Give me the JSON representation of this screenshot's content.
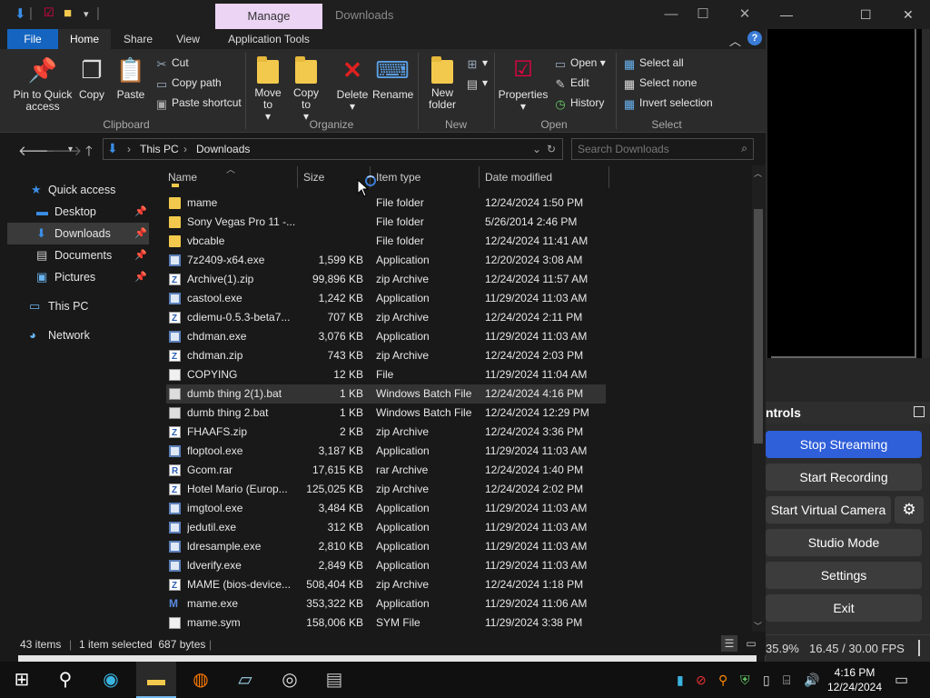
{
  "explorer": {
    "title": "Downloads",
    "manage_tab": "Manage",
    "window_controls": {
      "minimize": "—",
      "maximize": "☐",
      "close": "✕"
    },
    "ribbon_tabs": [
      "File",
      "Home",
      "Share",
      "View",
      "Application Tools"
    ],
    "help": "?",
    "ribbon": {
      "clipboard": {
        "label": "Clipboard",
        "pin": "Pin to Quick access",
        "copy": "Copy",
        "paste": "Paste",
        "cut": "Cut",
        "copy_path": "Copy path",
        "paste_shortcut": "Paste shortcut"
      },
      "organize": {
        "label": "Organize",
        "move_to": "Move to",
        "copy_to": "Copy to",
        "delete": "Delete",
        "rename": "Rename"
      },
      "new": {
        "label": "New",
        "new_folder": "New folder"
      },
      "open": {
        "label": "Open",
        "properties": "Properties",
        "open": "Open",
        "edit": "Edit",
        "history": "History"
      },
      "select": {
        "label": "Select",
        "select_all": "Select all",
        "select_none": "Select none",
        "invert": "Invert selection"
      }
    },
    "address": {
      "crumbs": [
        "This PC",
        "Downloads"
      ],
      "search_placeholder": "Search Downloads"
    },
    "nav": {
      "quick_access": "Quick access",
      "desktop": "Desktop",
      "downloads": "Downloads",
      "documents": "Documents",
      "pictures": "Pictures",
      "this_pc": "This PC",
      "network": "Network"
    },
    "columns": {
      "name": "Name",
      "size": "Size",
      "type": "Item type",
      "date": "Date modified"
    },
    "files": [
      {
        "name": "mame",
        "size": "",
        "type": "File folder",
        "date": "12/24/2024 1:50 PM",
        "icon": "folder"
      },
      {
        "name": "Sony Vegas Pro 11 -...",
        "size": "",
        "type": "File folder",
        "date": "5/26/2014 2:46 PM",
        "icon": "folder"
      },
      {
        "name": "vbcable",
        "size": "",
        "type": "File folder",
        "date": "12/24/2024 11:41 AM",
        "icon": "folder"
      },
      {
        "name": "7z2409-x64.exe",
        "size": "1,599 KB",
        "type": "Application",
        "date": "12/20/2024 3:08 AM",
        "icon": "app"
      },
      {
        "name": "Archive(1).zip",
        "size": "99,896 KB",
        "type": "zip Archive",
        "date": "12/24/2024 11:57 AM",
        "icon": "zip"
      },
      {
        "name": "castool.exe",
        "size": "1,242 KB",
        "type": "Application",
        "date": "11/29/2024 11:03 AM",
        "icon": "app"
      },
      {
        "name": "cdiemu-0.5.3-beta7...",
        "size": "707 KB",
        "type": "zip Archive",
        "date": "12/24/2024 2:11 PM",
        "icon": "zip"
      },
      {
        "name": "chdman.exe",
        "size": "3,076 KB",
        "type": "Application",
        "date": "11/29/2024 11:03 AM",
        "icon": "app"
      },
      {
        "name": "chdman.zip",
        "size": "743 KB",
        "type": "zip Archive",
        "date": "12/24/2024 2:03 PM",
        "icon": "zip"
      },
      {
        "name": "COPYING",
        "size": "12 KB",
        "type": "File",
        "date": "11/29/2024 11:04 AM",
        "icon": "file"
      },
      {
        "name": "dumb thing 2(1).bat",
        "size": "1 KB",
        "type": "Windows Batch File",
        "date": "12/24/2024 4:16 PM",
        "icon": "bat"
      },
      {
        "name": "dumb thing 2.bat",
        "size": "1 KB",
        "type": "Windows Batch File",
        "date": "12/24/2024 12:29 PM",
        "icon": "bat"
      },
      {
        "name": "FHAAFS.zip",
        "size": "2 KB",
        "type": "zip Archive",
        "date": "12/24/2024 3:36 PM",
        "icon": "zip"
      },
      {
        "name": "floptool.exe",
        "size": "3,187 KB",
        "type": "Application",
        "date": "11/29/2024 11:03 AM",
        "icon": "app"
      },
      {
        "name": "Gcom.rar",
        "size": "17,615 KB",
        "type": "rar Archive",
        "date": "12/24/2024 1:40 PM",
        "icon": "rar"
      },
      {
        "name": "Hotel Mario (Europ...",
        "size": "125,025 KB",
        "type": "zip Archive",
        "date": "12/24/2024 2:02 PM",
        "icon": "zip"
      },
      {
        "name": "imgtool.exe",
        "size": "3,484 KB",
        "type": "Application",
        "date": "11/29/2024 11:03 AM",
        "icon": "app"
      },
      {
        "name": "jedutil.exe",
        "size": "312 KB",
        "type": "Application",
        "date": "11/29/2024 11:03 AM",
        "icon": "app"
      },
      {
        "name": "ldresample.exe",
        "size": "2,810 KB",
        "type": "Application",
        "date": "11/29/2024 11:03 AM",
        "icon": "app"
      },
      {
        "name": "ldverify.exe",
        "size": "2,849 KB",
        "type": "Application",
        "date": "11/29/2024 11:03 AM",
        "icon": "app"
      },
      {
        "name": "MAME (bios-device...",
        "size": "508,404 KB",
        "type": "zip Archive",
        "date": "12/24/2024 1:18 PM",
        "icon": "zip"
      },
      {
        "name": "mame.exe",
        "size": "353,322 KB",
        "type": "Application",
        "date": "11/29/2024 11:06 AM",
        "icon": "mame"
      },
      {
        "name": "mame.sym",
        "size": "158,006 KB",
        "type": "SYM File",
        "date": "11/29/2024 3:38 PM",
        "icon": "file"
      }
    ],
    "status": {
      "items": "43 items",
      "selected": "1 item selected  687 bytes"
    }
  },
  "obs": {
    "controls_title": "ntrols",
    "buttons": {
      "stop_streaming": "Stop Streaming",
      "start_recording": "Start Recording",
      "start_virtual_camera": "Start Virtual Camera",
      "studio_mode": "Studio Mode",
      "settings": "Settings",
      "exit": "Exit"
    },
    "status_percent": "35.9%",
    "status_fps": "16.45 / 30.00 FPS",
    "accent": "#2f5fd9"
  },
  "taskbar": {
    "time": "4:16 PM",
    "date": "12/24/2024"
  }
}
